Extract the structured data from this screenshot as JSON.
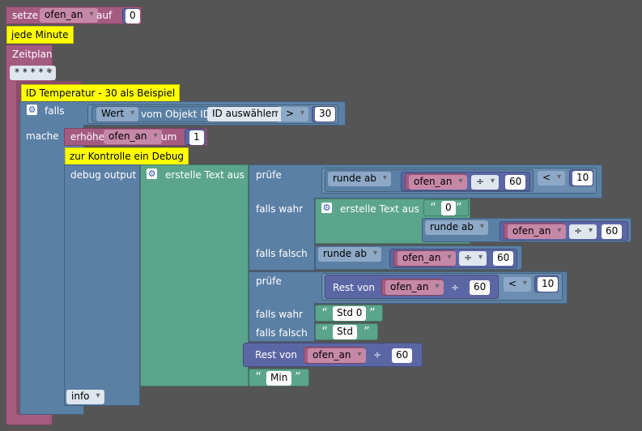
{
  "set_block": {
    "label_set": "setze",
    "variable": "ofen_an",
    "label_to": "auf",
    "value": "0"
  },
  "comment_minute": "jede Minute",
  "schedule": {
    "label": "Zeitplan",
    "cron": "* * * * *"
  },
  "comment_temp": "ID Temperatur - 30 als Beispiel",
  "if_block": {
    "label_if": "falls",
    "label_do": "mache"
  },
  "condition": {
    "value_dd": "Wert",
    "label_of": "vom Objekt ID",
    "id_button": "ID auswählen",
    "operator": ">",
    "threshold": "30"
  },
  "increment": {
    "label": "erhöhe",
    "variable": "ofen_an",
    "label_by": "um",
    "value": "1"
  },
  "comment_debug": "zur Kontrolle ein Debug",
  "debug": {
    "label": "debug output",
    "level": "info"
  },
  "text_join": {
    "label": "erstelle Text aus"
  },
  "ternary1": {
    "label_test": "prüfe",
    "label_true": "falls wahr",
    "label_false": "falls falsch",
    "round_op": "runde ab",
    "variable": "ofen_an",
    "div_op": "÷",
    "divisor": "60",
    "cmp": "<",
    "cmp_value": "10",
    "inner_text_label": "erstelle Text aus",
    "zero_text": "0"
  },
  "ternary2": {
    "label_test": "prüfe",
    "label_true": "falls wahr",
    "label_false": "falls falsch",
    "rest_label": "Rest von",
    "variable": "ofen_an",
    "div_op": "÷",
    "divisor": "60",
    "cmp": "<",
    "cmp_value": "10",
    "true_text": "Std 0",
    "false_text": "Std"
  },
  "rest_block": {
    "label": "Rest von",
    "variable": "ofen_an",
    "div_op": "÷",
    "divisor": "60"
  },
  "min_text": "Min"
}
